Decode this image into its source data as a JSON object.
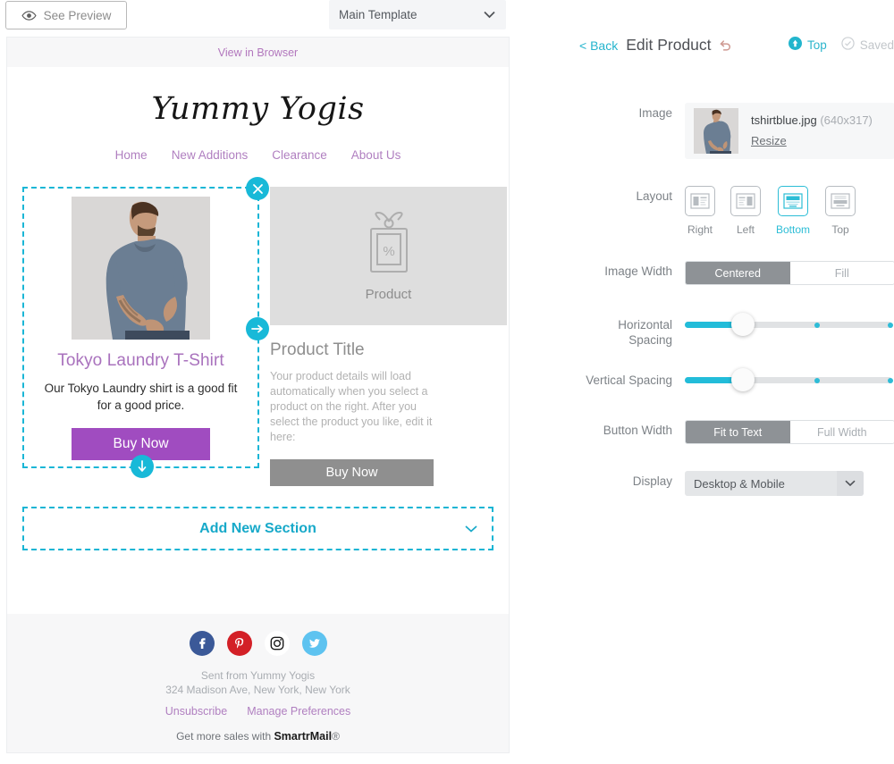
{
  "toolbar": {
    "preview_label": "See Preview",
    "preview_icon": "eye-icon",
    "template_value": "Main Template",
    "template_caret_icon": "chevron-down-icon"
  },
  "email": {
    "view_in_browser": "View in Browser",
    "brand": "Yummy Yogis",
    "nav": [
      "Home",
      "New Additions",
      "Clearance",
      "About Us"
    ],
    "selected_card": {
      "title": "Tokyo Laundry T-Shirt",
      "description": "Our Tokyo Laundry shirt is a good fit for a good price.",
      "button_label": "Buy Now",
      "handles": {
        "close_icon": "close-icon",
        "right_icon": "arrow-right-icon",
        "down_icon": "arrow-down-icon"
      }
    },
    "placeholder_card": {
      "image_icon": "price-tag-percent-icon",
      "image_label": "Product",
      "title": "Product Title",
      "description": "Your product details will load automatically when you select a product on the right. After you select the product you like, edit it here:",
      "button_label": "Buy Now"
    },
    "add_new_section": {
      "label": "Add New Section",
      "caret_icon": "chevron-down-icon"
    },
    "footer": {
      "socials": [
        "facebook-icon",
        "pinterest-icon",
        "instagram-icon",
        "twitter-icon"
      ],
      "sent_from": "Sent from Yummy Yogis",
      "address": "324 Madison Ave, New York, New York",
      "unsubscribe": "Unsubscribe",
      "manage_preferences": "Manage Preferences",
      "get_more_prefix": "Get more sales with ",
      "get_more_brand": "SmartrMail",
      "get_more_suffix": "®"
    }
  },
  "panel": {
    "back": "< Back",
    "title": "Edit Product",
    "undo_icon": "undo-icon",
    "top_label": "Top",
    "top_icon": "arrow-up-circle-icon",
    "saved_label": "Saved",
    "saved_icon": "check-circle-icon",
    "rows": {
      "image": {
        "label": "Image",
        "filename": "tshirtblue.jpg",
        "dimensions": "(640x317)",
        "resize": "Resize"
      },
      "layout": {
        "label": "Layout",
        "options": [
          {
            "label": "Right",
            "icon": "layout-right-icon",
            "selected": false
          },
          {
            "label": "Left",
            "icon": "layout-left-icon",
            "selected": false
          },
          {
            "label": "Bottom",
            "icon": "layout-bottom-icon",
            "selected": true
          },
          {
            "label": "Top",
            "icon": "layout-top-icon",
            "selected": false
          }
        ]
      },
      "image_width": {
        "label": "Image Width",
        "options": [
          "Centered",
          "Fill"
        ],
        "selected": "Centered"
      },
      "horizontal_spacing": {
        "label": "Horizontal Spacing",
        "label_line1": "Horizontal",
        "label_line2": "Spacing",
        "value_pct": 28,
        "ticks_pct": [
          64,
          99
        ]
      },
      "vertical_spacing": {
        "label": "Vertical Spacing",
        "value_pct": 28,
        "ticks_pct": [
          64,
          99
        ]
      },
      "button_width": {
        "label": "Button Width",
        "options": [
          "Fit to Text",
          "Full Width"
        ],
        "selected": "Fit to Text"
      },
      "display": {
        "label": "Display",
        "value": "Desktop & Mobile",
        "caret_icon": "chevron-down-icon"
      }
    }
  },
  "colors": {
    "accent_teal": "#22bcd9",
    "brand_purple": "#a04cc0",
    "link_purple": "#b07fc0",
    "grey_button": "#8f8f8f"
  }
}
